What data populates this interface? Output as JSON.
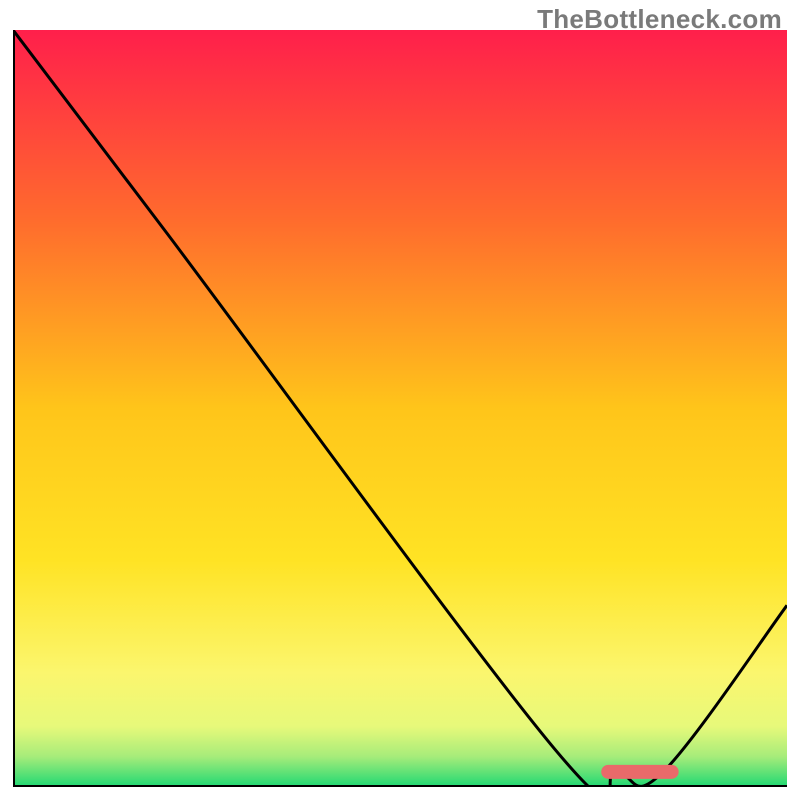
{
  "watermark": "TheBottleneck.com",
  "chart_data": {
    "type": "line",
    "title": "",
    "xlabel": "",
    "ylabel": "",
    "xlim": [
      0,
      100
    ],
    "ylim": [
      0,
      100
    ],
    "x": [
      0,
      20,
      70,
      78,
      84,
      100
    ],
    "values": [
      100,
      73,
      5,
      2,
      2,
      24
    ],
    "marker": {
      "x_start": 76,
      "x_end": 86,
      "y": 2
    },
    "background_gradient": {
      "stops": [
        {
          "offset": 0.0,
          "color": "#ff1f4b"
        },
        {
          "offset": 0.25,
          "color": "#ff6b2d"
        },
        {
          "offset": 0.5,
          "color": "#ffc51a"
        },
        {
          "offset": 0.7,
          "color": "#ffe324"
        },
        {
          "offset": 0.85,
          "color": "#fbf66e"
        },
        {
          "offset": 0.92,
          "color": "#e7f97a"
        },
        {
          "offset": 0.96,
          "color": "#a6ec7a"
        },
        {
          "offset": 1.0,
          "color": "#1fd873"
        }
      ]
    },
    "curve_stroke": "#000000",
    "marker_color": "#e96a6a",
    "axis_stroke": "#000000"
  }
}
